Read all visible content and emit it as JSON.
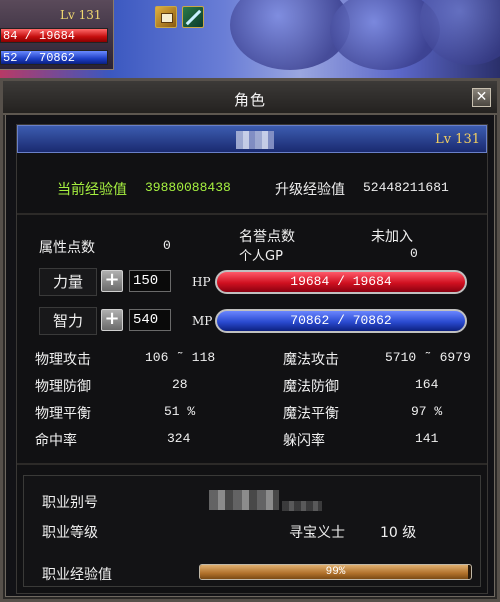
{
  "hud": {
    "level": "Lv 131",
    "hp_text": "84 / 19684",
    "mp_text": "52 / 70862"
  },
  "quickbar": [
    "scroll-icon",
    "sword-icon"
  ],
  "window": {
    "title": "角色",
    "close_label": "✕"
  },
  "character": {
    "level": "Lv 131"
  },
  "exp": {
    "current_label": "当前经验值",
    "current_value": "39880088438",
    "next_label": "升级经验值",
    "next_value": "52448211681"
  },
  "points": {
    "attr_label": "属性点数",
    "attr_value": "0",
    "honor_label": "名誉点数",
    "honor_value": "未加入",
    "gp_label": "个人GP",
    "gp_value": "0"
  },
  "stats": {
    "str_label": "力量",
    "str_value": "150",
    "int_label": "智力",
    "int_value": "540",
    "hp_tag": "HP",
    "mp_tag": "MP",
    "hp_text": "19684 / 19684",
    "mp_text": "70862 / 70862",
    "hp_fraction": 1.0,
    "mp_fraction": 1.0
  },
  "combat": {
    "phys_atk_label": "物理攻击",
    "phys_atk_value": "106 ˜ 118",
    "phys_def_label": "物理防御",
    "phys_def_value": "28",
    "phys_bal_label": "物理平衡",
    "phys_bal_value": "51 %",
    "hit_label": "命中率",
    "hit_value": "324",
    "mag_atk_label": "魔法攻击",
    "mag_atk_value": "5710 ˜ 6979",
    "mag_def_label": "魔法防御",
    "mag_def_value": "164",
    "mag_bal_label": "魔法平衡",
    "mag_bal_value": "97 %",
    "dodge_label": "躲闪率",
    "dodge_value": "141"
  },
  "job": {
    "alias_label": "职业别号",
    "level_label": "职业等级",
    "title": "寻宝义士",
    "level_value": "10 级",
    "exp_label": "职业经验值",
    "exp_text": "99%",
    "exp_fraction": 0.99
  },
  "colors": {
    "exp_green": "#a6f040",
    "points_yellow": "#f0d23a",
    "hp_red": "#d01020",
    "mp_blue": "#2a4ad0",
    "job_exp_orange": "#b0702a"
  }
}
